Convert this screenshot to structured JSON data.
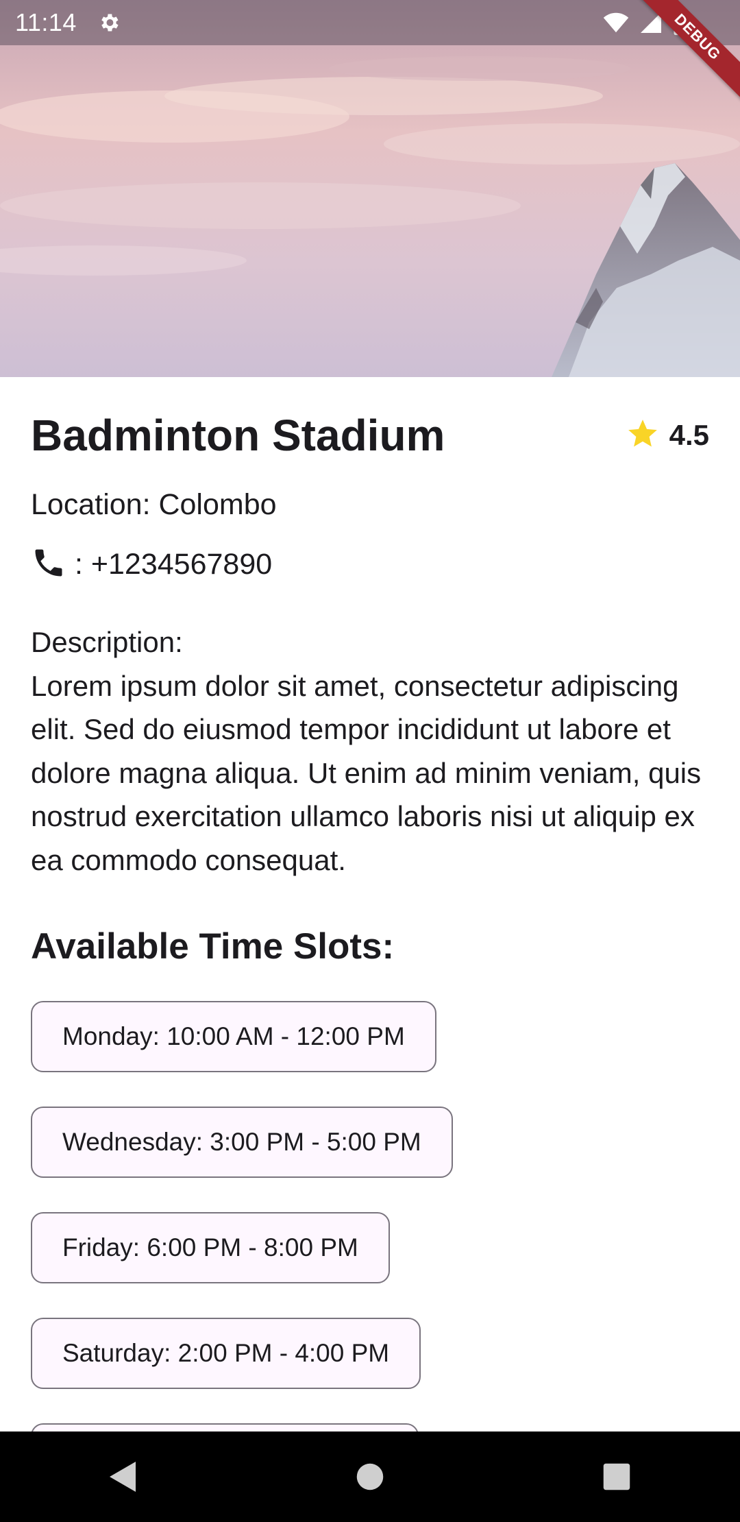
{
  "status_bar": {
    "time": "11:14",
    "settings_icon": "gear-icon",
    "wifi_icon": "wifi-icon",
    "signal_icon": "cell-signal-icon",
    "battery_icon": "battery-icon"
  },
  "debug_banner": {
    "label": "DEBUG",
    "color": "#a4262d"
  },
  "hero": {
    "image": "mountain-peak-sunset-photo"
  },
  "venue": {
    "title": "Badminton Stadium",
    "rating_icon": "star-icon",
    "rating_color": "#f9d427",
    "rating": "4.5",
    "location": "Location: Colombo",
    "phone_icon": "phone-icon",
    "phone": ": +1234567890",
    "description_label": "Description:",
    "description": "Lorem ipsum dolor sit amet, consectetur adipiscing elit. Sed do eiusmod tempor incididunt ut labore et dolore magna aliqua. Ut enim ad minim veniam, quis nostrud exercitation ullamco laboris nisi ut aliquip ex ea commodo consequat."
  },
  "slots": {
    "heading": "Available Time Slots:",
    "items": [
      "Monday: 10:00 AM - 12:00 PM",
      "Wednesday: 3:00 PM - 5:00 PM",
      "Friday: 6:00 PM - 8:00 PM",
      "Saturday: 2:00 PM - 4:00 PM",
      ""
    ]
  },
  "nav_bar": {
    "back_icon": "back-triangle-icon",
    "home_icon": "home-circle-icon",
    "recents_icon": "recents-square-icon"
  }
}
